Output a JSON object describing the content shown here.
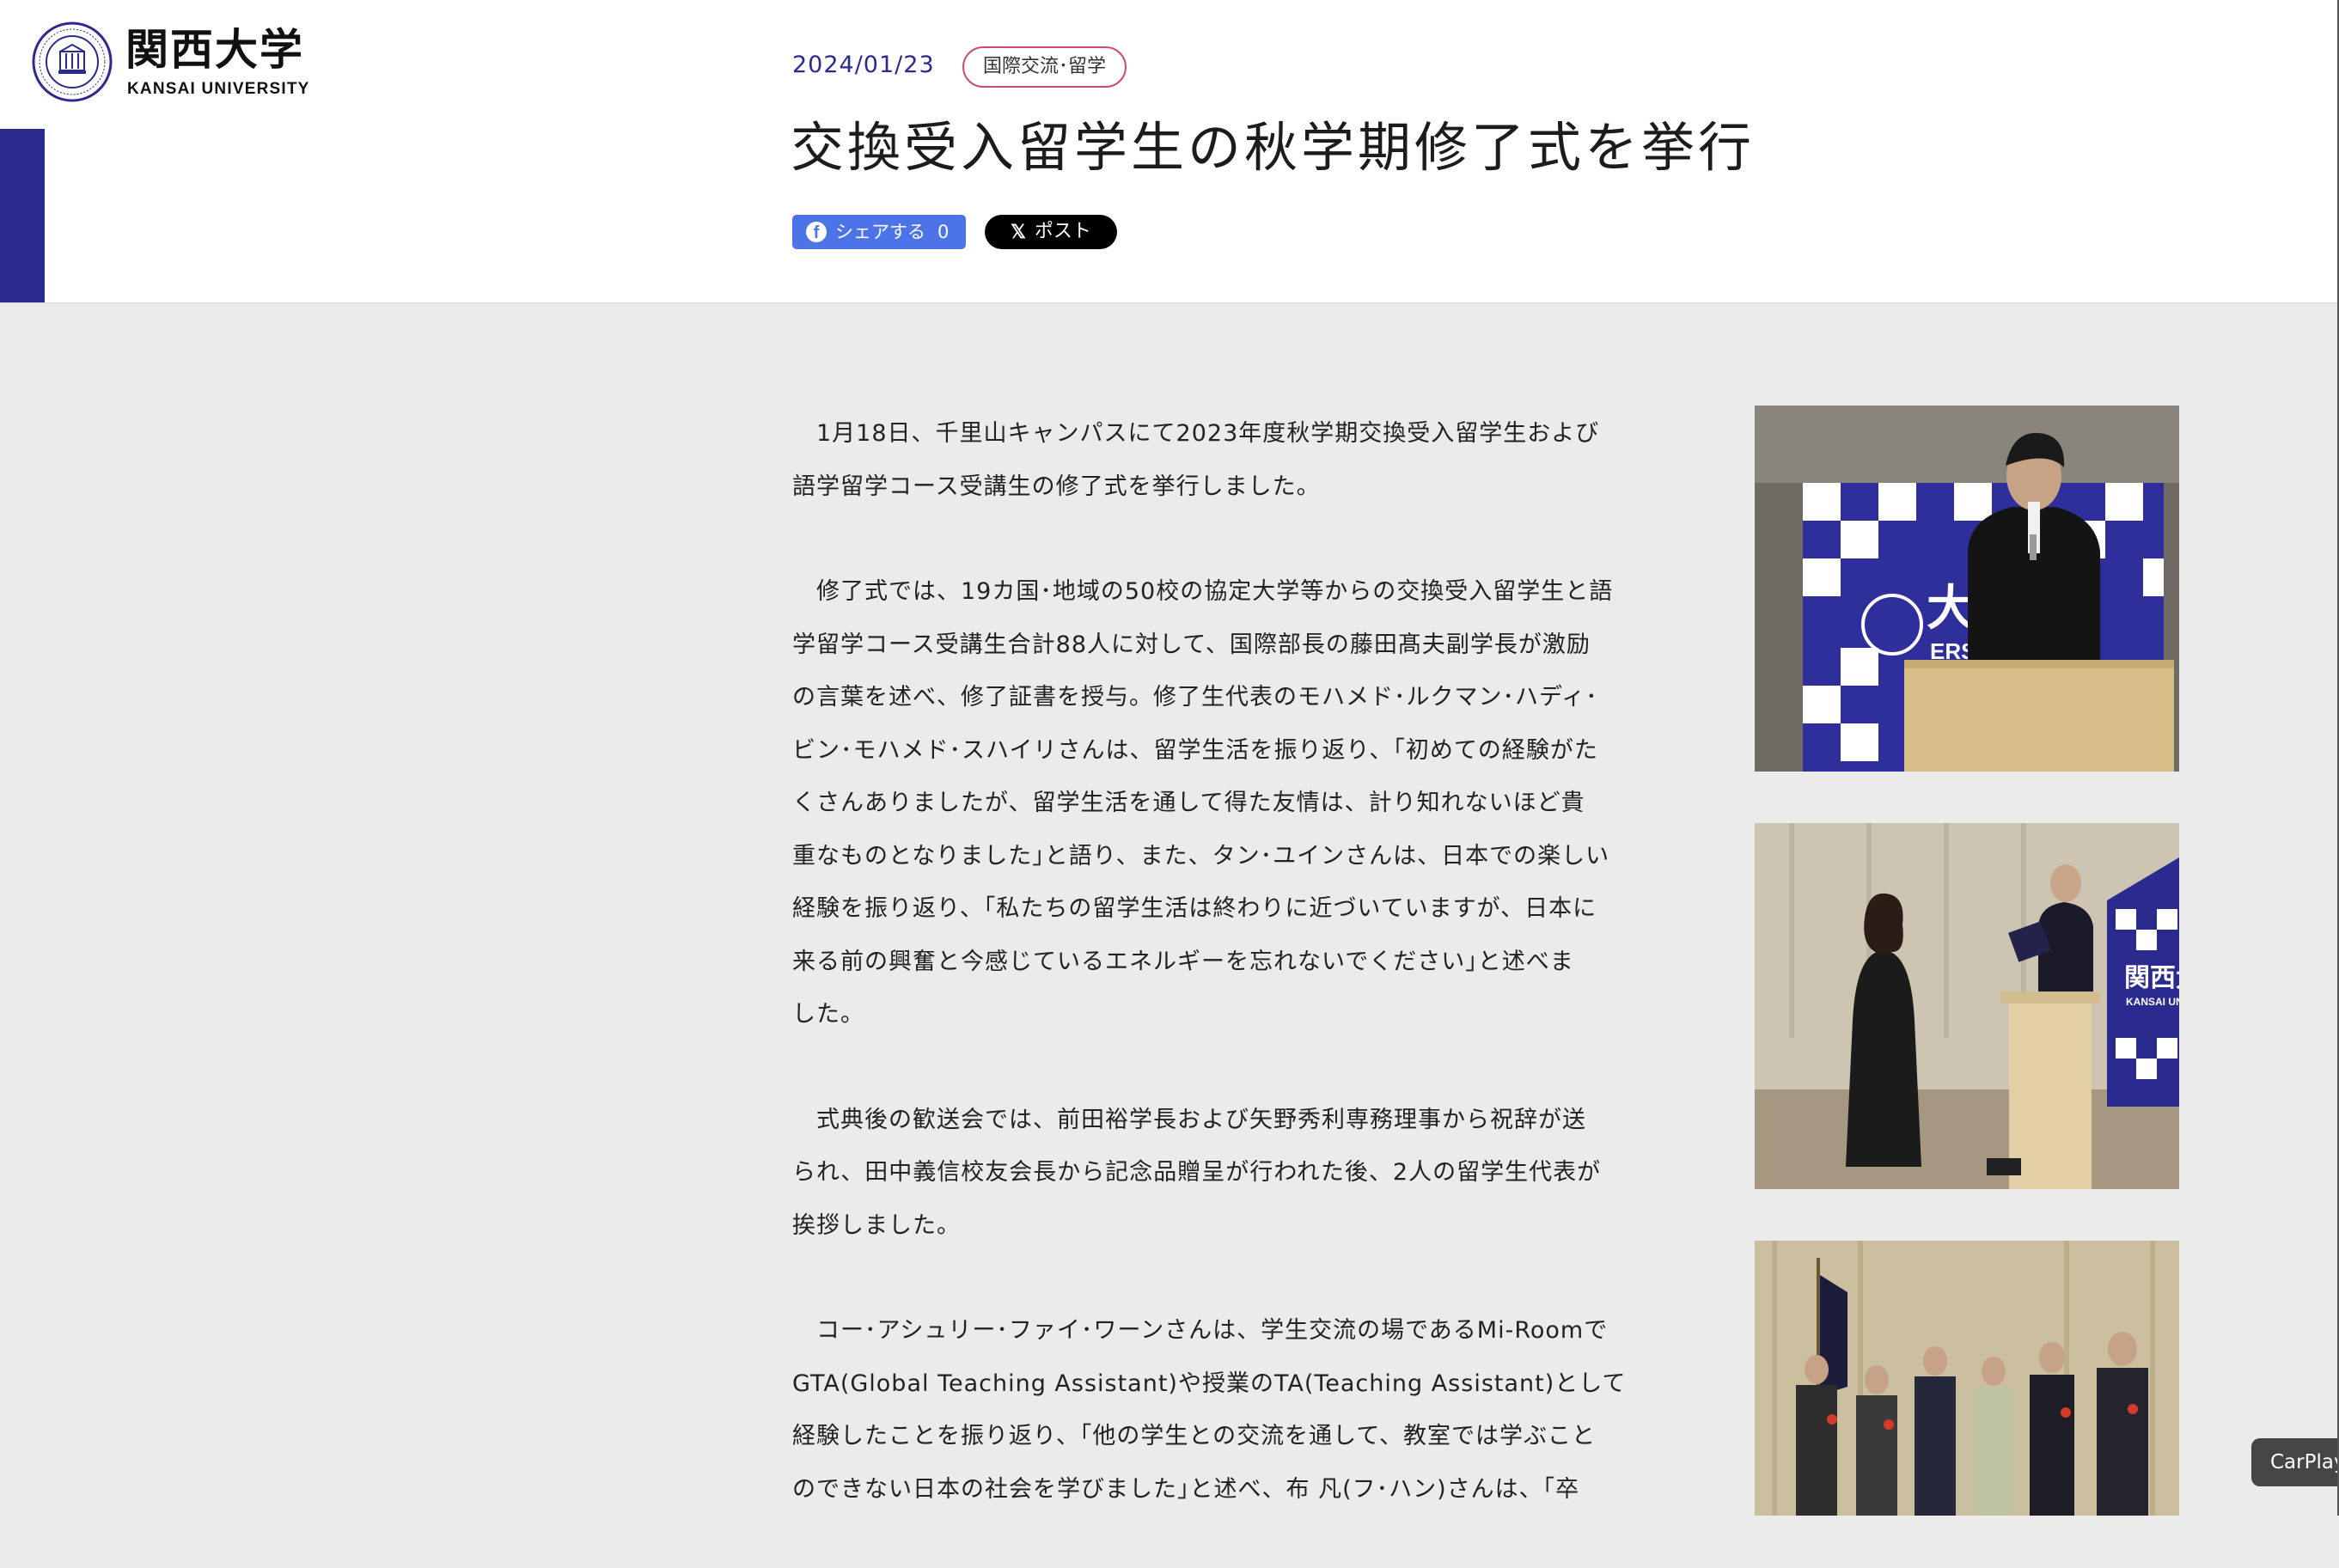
{
  "logo": {
    "name_jp": "関西大学",
    "name_en": "KANSAI UNIVERSITY",
    "seal_icon": "university-seal-icon"
  },
  "article": {
    "date": "2024/01/23",
    "category": "国際交流･留学",
    "title": "交換受入留学生の秋学期修了式を挙行",
    "paragraphs": [
      "　1月18日、千里山キャンパスにて2023年度秋学期交換受入留学生および\n語学留学コース受講生の修了式を挙行しました。",
      "　修了式では、19カ国･地域の50校の協定大学等からの交換受入留学生と語\n学留学コース受講生合計88人に対して、国際部長の藤田髙夫副学長が激励\nの言葉を述べ、修了証書を授与。修了生代表のモハメド･ルクマン･ハディ･\nビン･モハメド･スハイリさんは、留学生活を振り返り、｢初めての経験がた\nくさんありましたが、留学生活を通して得た友情は、計り知れないほど貴\n重なものとなりました｣と語り、また、タン･ユインさんは、日本での楽しい\n経験を振り返り、｢私たちの留学生活は終わりに近づいていますが、日本に\n来る前の興奮と今感じているエネルギーを忘れないでください｣と述べま\nした。",
      "　式典後の歓送会では、前田裕学長および矢野秀利専務理事から祝辞が送\nられ、田中義信校友会長から記念品贈呈が行われた後、2人の留学生代表が\n挨拶しました。",
      "　コー･アシュリー･ファイ･ワーンさんは、学生交流の場であるMi-Roomで\nGTA(Global Teaching Assistant)や授業のTA(Teaching Assistant)として\n経験したことを振り返り、｢他の学生との交流を通して、教室では学ぶこと\nのできない日本の社会を学びました｣と述べ、布 凡(フ･ハン)さんは、｢卒"
    ]
  },
  "share": {
    "facebook_label": "シェアする",
    "facebook_count": "0",
    "x_label": "ポスト"
  },
  "photo_banner": {
    "name_jp": "関西大学",
    "name_en": "KANSAI UNIVERSITY",
    "big_jp": "大学",
    "big_en": "ERSITY"
  },
  "overlay": {
    "carplay_label": "CarPlay"
  },
  "colors": {
    "brand": "#2b2a8f",
    "category_border": "#c8506e",
    "facebook": "#4c74e8"
  }
}
